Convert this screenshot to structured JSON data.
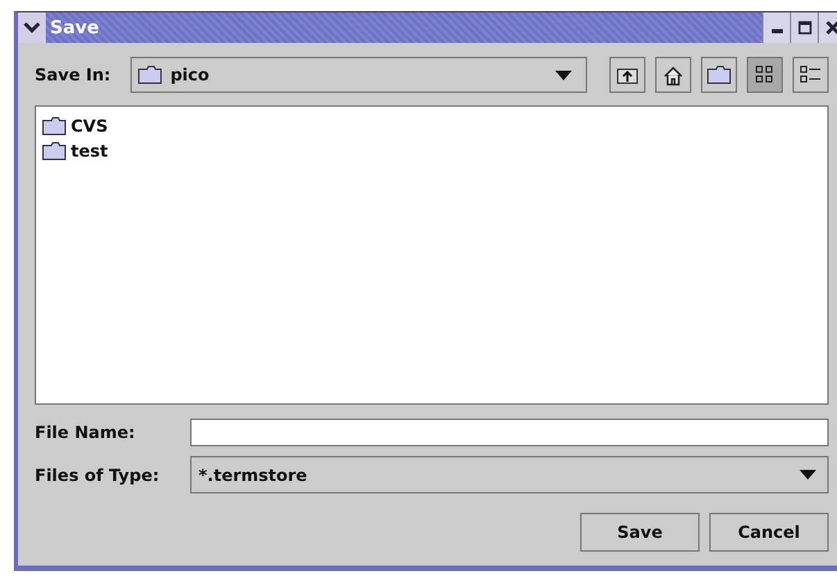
{
  "window": {
    "title": "Save"
  },
  "save_in": {
    "label": "Save In:",
    "value": "pico"
  },
  "view_buttons": [
    {
      "kind": "list",
      "selected": true
    },
    {
      "kind": "details",
      "selected": false
    }
  ],
  "files": [
    {
      "name": "CVS"
    },
    {
      "name": "test"
    }
  ],
  "file_name": {
    "label": "File Name:"
  },
  "file_type": {
    "label": "Files of Type:",
    "value": "*.termstore"
  },
  "buttons": [
    "Save",
    "Cancel"
  ]
}
